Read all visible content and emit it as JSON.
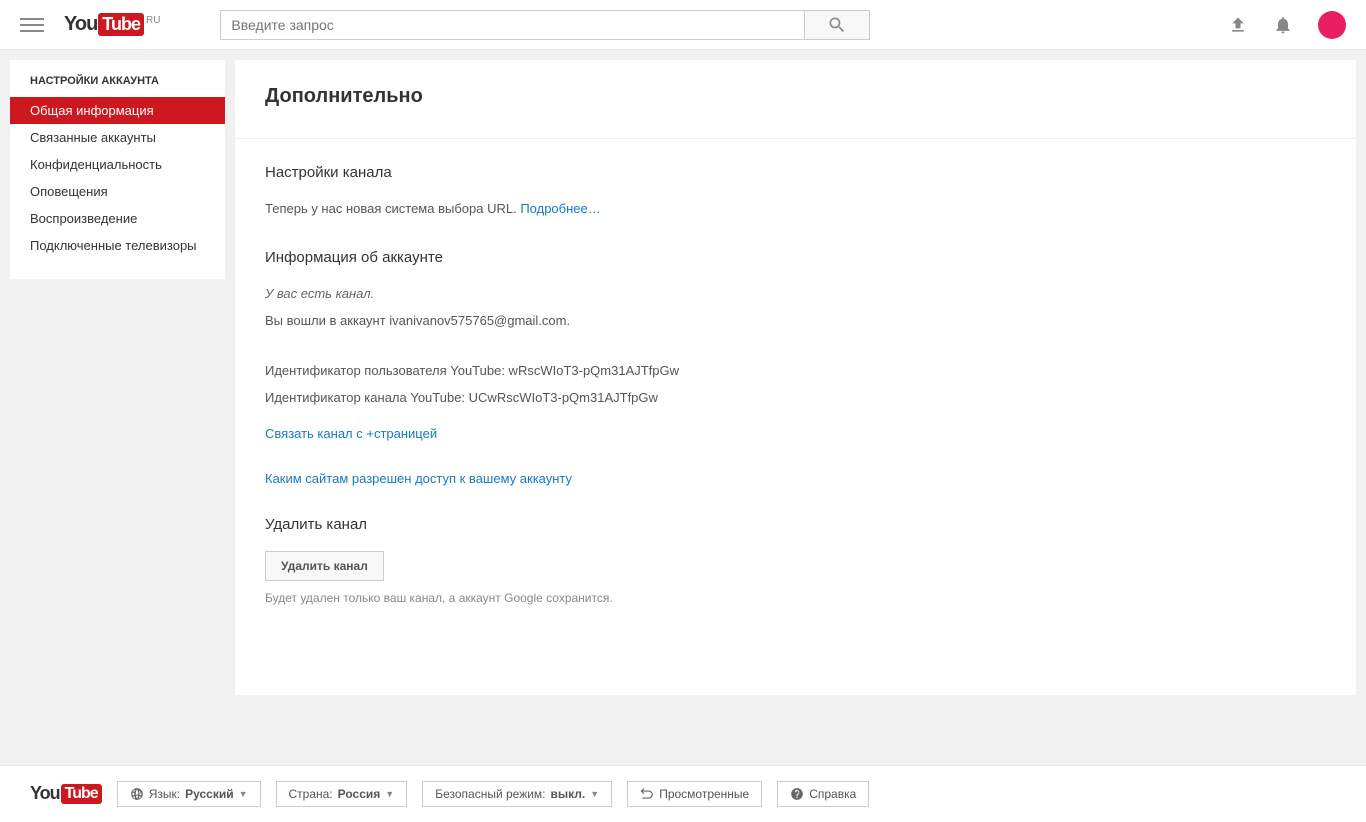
{
  "header": {
    "logo_ru": "RU",
    "search_placeholder": "Введите запрос"
  },
  "sidebar": {
    "title": "НАСТРОЙКИ АККАУНТА",
    "items": [
      {
        "label": "Общая информация",
        "active": true
      },
      {
        "label": "Связанные аккаунты",
        "active": false
      },
      {
        "label": "Конфиденциальность",
        "active": false
      },
      {
        "label": "Оповещения",
        "active": false
      },
      {
        "label": "Воспроизведение",
        "active": false
      },
      {
        "label": "Подключенные телевизоры",
        "active": false
      }
    ]
  },
  "main": {
    "page_title": "Дополнительно",
    "channel_settings": {
      "title": "Настройки канала",
      "text": "Теперь у нас новая система выбора URL. ",
      "link": "Подробнее…"
    },
    "account_info": {
      "title": "Информация об аккаунте",
      "you_have_channel": "У вас есть канал.",
      "signed_in_as": "Вы вошли в аккаунт ivanivanov575765@gmail.com.",
      "user_id": "Идентификатор пользователя YouTube: wRscWIoT3-pQm31AJTfpGw",
      "channel_id": "Идентификатор канала YouTube: UCwRscWIoT3-pQm31AJTfpGw",
      "link_plus_page": "Связать канал с +страницей",
      "sites_access": "Каким сайтам разрешен доступ к вашему аккаунту"
    },
    "delete_channel": {
      "title": "Удалить канал",
      "button": "Удалить канал",
      "note": "Будет удален только ваш канал, а аккаунт Google сохранится."
    }
  },
  "footer": {
    "lang_label": "Язык: ",
    "lang_value": "Русский",
    "country_label": "Страна: ",
    "country_value": "Россия",
    "safe_label": "Безопасный режим: ",
    "safe_value": "выкл.",
    "history": "Просмотренные",
    "help": "Справка"
  }
}
